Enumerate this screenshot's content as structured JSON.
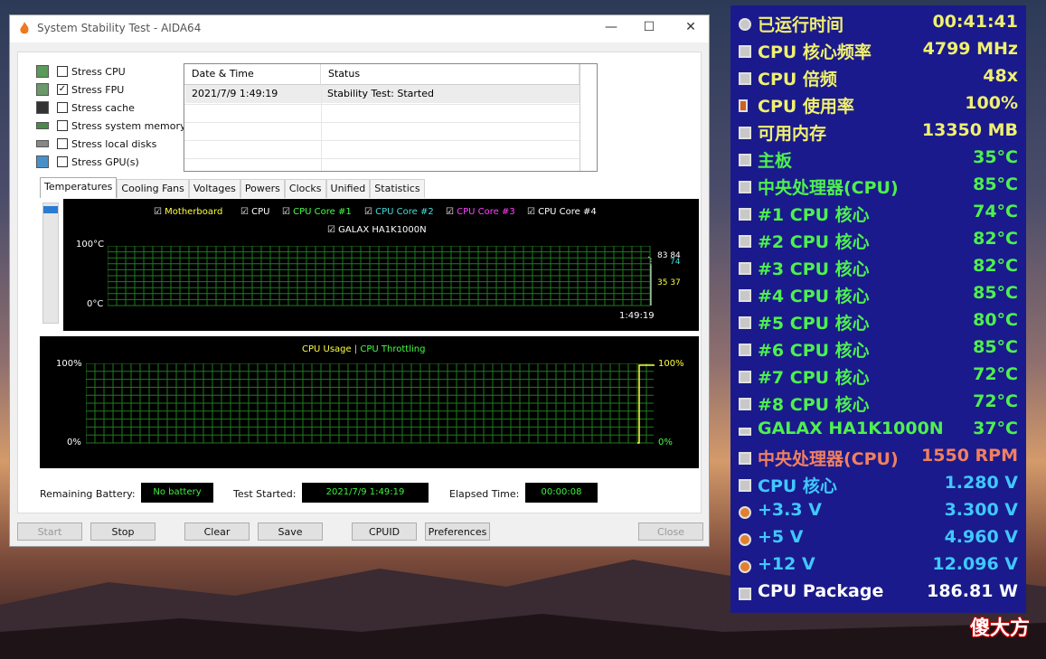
{
  "window": {
    "title": "System Stability Test - AIDA64",
    "controls": {
      "minimize": "—",
      "maximize": "☐",
      "close": "✕"
    }
  },
  "stress_options": [
    {
      "label": "Stress CPU",
      "checked": false
    },
    {
      "label": "Stress FPU",
      "checked": true
    },
    {
      "label": "Stress cache",
      "checked": false
    },
    {
      "label": "Stress system memory",
      "checked": false
    },
    {
      "label": "Stress local disks",
      "checked": false
    },
    {
      "label": "Stress GPU(s)",
      "checked": false
    }
  ],
  "log": {
    "col_datetime": "Date & Time",
    "col_status": "Status",
    "rows": [
      {
        "datetime": "2021/7/9 1:49:19",
        "status": "Stability Test: Started"
      }
    ]
  },
  "tabs": [
    "Temperatures",
    "Cooling Fans",
    "Voltages",
    "Powers",
    "Clocks",
    "Unified",
    "Statistics"
  ],
  "temp_graph": {
    "legend": [
      {
        "label": "Motherboard",
        "color": "#ffff3c"
      },
      {
        "label": "CPU",
        "color": "#ffffff"
      },
      {
        "label": "CPU Core #1",
        "color": "#44ff44"
      },
      {
        "label": "CPU Core #2",
        "color": "#44dddd"
      },
      {
        "label": "CPU Core #3",
        "color": "#ff44ff"
      },
      {
        "label": "CPU Core #4",
        "color": "#ffffff"
      },
      {
        "label": "GALAX HA1K1000N",
        "color": "#ffffff"
      }
    ],
    "y_top": "100°C",
    "y_bottom": "0°C",
    "time": "1:49:19",
    "end_values": {
      "a": "83",
      "b": "84",
      "c": "74",
      "d": "35",
      "e": "37"
    }
  },
  "usage_graph": {
    "legend_usage": "CPU Usage",
    "legend_sep": "|",
    "legend_throttle": "CPU Throttling",
    "y_top": "100%",
    "y_bottom": "0%",
    "right_top": "100%",
    "right_bottom": "0%"
  },
  "status": {
    "battery_label": "Remaining Battery:",
    "battery_value": "No battery",
    "started_label": "Test Started:",
    "started_value": "2021/7/9 1:49:19",
    "elapsed_label": "Elapsed Time:",
    "elapsed_value": "00:00:08"
  },
  "buttons": {
    "start": "Start",
    "stop": "Stop",
    "clear": "Clear",
    "save": "Save",
    "cpuid": "CPUID",
    "preferences": "Preferences",
    "close": "Close"
  },
  "overlay": [
    {
      "label": "已运行时间",
      "value": "00:41:41",
      "color": "#f0f070",
      "icon": "clock-icon"
    },
    {
      "label": "CPU 核心频率",
      "value": "4799 MHz",
      "color": "#f0f070",
      "icon": "chip-icon"
    },
    {
      "label": "CPU 倍频",
      "value": "48x",
      "color": "#f0f070",
      "icon": "chip-icon"
    },
    {
      "label": "CPU 使用率",
      "value": "100%",
      "color": "#f0f070",
      "icon": "hourglass-icon"
    },
    {
      "label": "可用内存",
      "value": "13350 MB",
      "color": "#f0f070",
      "icon": "memory-icon"
    },
    {
      "label": "主板",
      "value": "35°C",
      "color": "#4ef04e",
      "icon": "motherboard-icon"
    },
    {
      "label": "中央处理器(CPU)",
      "value": "85°C",
      "color": "#4ef04e",
      "icon": "chip-icon"
    },
    {
      "label": " #1 CPU 核心",
      "value": "74°C",
      "color": "#4ef04e",
      "icon": "chip-icon"
    },
    {
      "label": " #2 CPU 核心",
      "value": "82°C",
      "color": "#4ef04e",
      "icon": "chip-icon"
    },
    {
      "label": " #3 CPU 核心",
      "value": "82°C",
      "color": "#4ef04e",
      "icon": "chip-icon"
    },
    {
      "label": " #4 CPU 核心",
      "value": "85°C",
      "color": "#4ef04e",
      "icon": "chip-icon"
    },
    {
      "label": " #5 CPU 核心",
      "value": "80°C",
      "color": "#4ef04e",
      "icon": "chip-icon"
    },
    {
      "label": " #6 CPU 核心",
      "value": "85°C",
      "color": "#4ef04e",
      "icon": "chip-icon"
    },
    {
      "label": " #7 CPU 核心",
      "value": "72°C",
      "color": "#4ef04e",
      "icon": "chip-icon"
    },
    {
      "label": " #8 CPU 核心",
      "value": "72°C",
      "color": "#4ef04e",
      "icon": "chip-icon"
    },
    {
      "label": "GALAX HA1K1000N",
      "value": "37°C",
      "color": "#4ef04e",
      "icon": "disk-icon"
    },
    {
      "label": "中央处理器(CPU)",
      "value": "1550 RPM",
      "color": "#f08060",
      "icon": "chip-icon"
    },
    {
      "label": "CPU 核心",
      "value": "1.280 V",
      "color": "#40c8ff",
      "icon": "chip-icon"
    },
    {
      "label": "+3.3 V",
      "value": "3.300 V",
      "color": "#40c8ff",
      "icon": "bolt-icon"
    },
    {
      "label": "+5 V",
      "value": "4.960 V",
      "color": "#40c8ff",
      "icon": "bolt-icon"
    },
    {
      "label": "+12 V",
      "value": "12.096 V",
      "color": "#40c8ff",
      "icon": "bolt-icon"
    },
    {
      "label": "CPU Package",
      "value": "186.81 W",
      "color": "#ffffff",
      "icon": "chip-icon"
    }
  ],
  "watermark": "傻大方"
}
